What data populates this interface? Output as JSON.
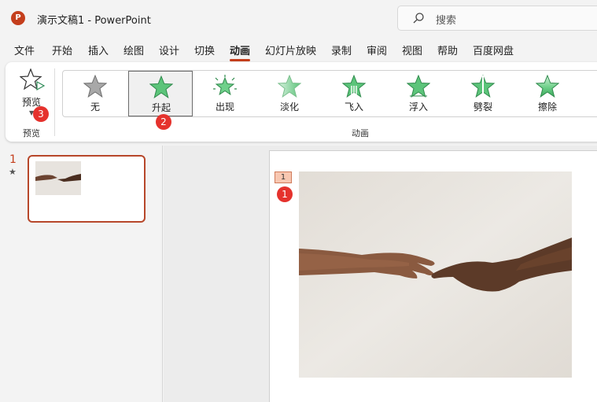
{
  "app": {
    "title": "演示文稿1  -  PowerPoint",
    "logo_letter": "P",
    "search_placeholder": "搜索"
  },
  "menu": {
    "tabs": [
      {
        "label": "文件"
      },
      {
        "label": "开始"
      },
      {
        "label": "插入"
      },
      {
        "label": "绘图"
      },
      {
        "label": "设计"
      },
      {
        "label": "切换"
      },
      {
        "label": "动画",
        "active": true
      },
      {
        "label": "幻灯片放映"
      },
      {
        "label": "录制"
      },
      {
        "label": "审阅"
      },
      {
        "label": "视图"
      },
      {
        "label": "帮助"
      },
      {
        "label": "百度网盘"
      }
    ]
  },
  "ribbon": {
    "preview": {
      "label": "预览",
      "group_label": "预览"
    },
    "animations": {
      "group_label": "动画",
      "items": [
        {
          "label": "无",
          "icon": "star-gray-icon"
        },
        {
          "label": "升起",
          "icon": "star-green-icon",
          "selected": true
        },
        {
          "label": "出现",
          "icon": "star-burst-icon"
        },
        {
          "label": "淡化",
          "icon": "star-fade-icon"
        },
        {
          "label": "飞入",
          "icon": "star-flyin-icon"
        },
        {
          "label": "浮入",
          "icon": "star-floatin-icon"
        },
        {
          "label": "劈裂",
          "icon": "star-split-icon"
        },
        {
          "label": "擦除",
          "icon": "star-wipe-icon"
        }
      ]
    }
  },
  "badges": {
    "b1": "1",
    "b2": "2",
    "b3": "3"
  },
  "slides_panel": {
    "slide_number": "1",
    "animation_marker": "★"
  },
  "slide": {
    "animation_tag": "1"
  },
  "colors": {
    "accent": "#c43e1c",
    "star_green": "#5cc47a",
    "badge_red": "#e5322d"
  }
}
